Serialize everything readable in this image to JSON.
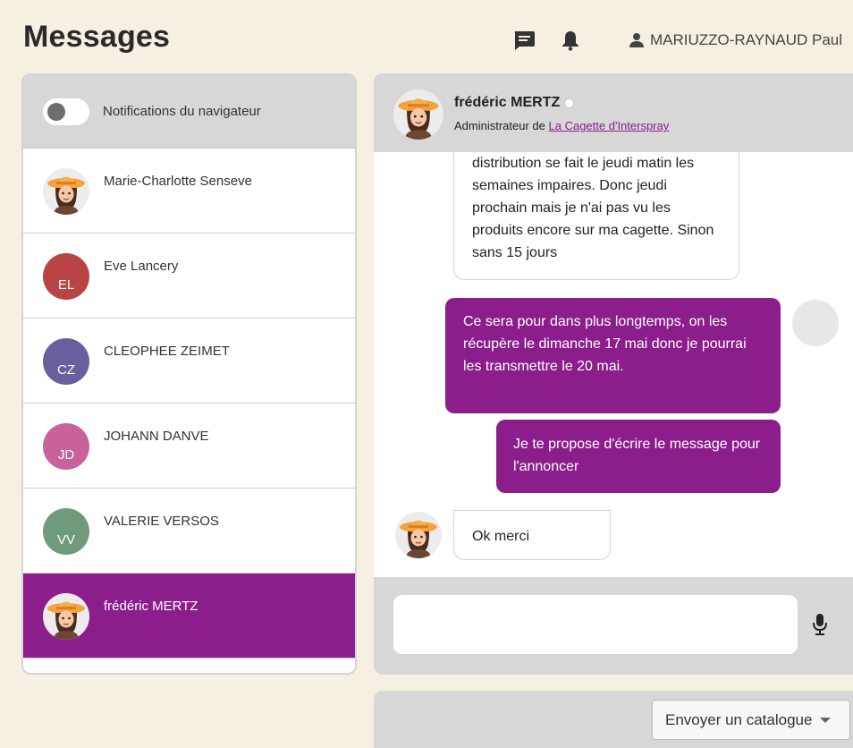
{
  "page": {
    "title": "Messages"
  },
  "header": {
    "user_name": "MARIUZZO-RAYNAUD Paul",
    "icons": [
      "chat-icon",
      "bell-icon",
      "user-icon"
    ]
  },
  "sidebar": {
    "notification_toggle_label": "Notifications du navigateur",
    "notification_toggle_on": false,
    "conversations": [
      {
        "name": "Marie-Charlotte Senseve",
        "initials": "",
        "avatar": "farmer-avatar",
        "color": "#eeeeee",
        "active": false
      },
      {
        "name": "Eve Lancery",
        "initials": "EL",
        "avatar": "initials",
        "color": "#b94444",
        "active": false
      },
      {
        "name": "CLEOPHEE ZEIMET",
        "initials": "CZ",
        "avatar": "initials",
        "color": "#6a5f9e",
        "active": false
      },
      {
        "name": "JOHANN DANVE",
        "initials": "JD",
        "avatar": "initials",
        "color": "#c9629c",
        "active": false
      },
      {
        "name": "VALERIE VERSOS",
        "initials": "VV",
        "avatar": "initials",
        "color": "#6f9a7b",
        "active": false
      },
      {
        "name": "frédéric MERTZ",
        "initials": "",
        "avatar": "farmer-avatar",
        "color": "#8b1e8b",
        "active": true
      }
    ]
  },
  "chat": {
    "contact_name": "frédéric MERTZ",
    "contact_status": "offline",
    "role_prefix": "Administrateur de",
    "role_link": "La Cagette d'Interspray",
    "messages": [
      {
        "direction": "in",
        "text": "distribution se fait le jeudi matin les semaines impaires. Donc jeudi prochain mais je n'ai pas vu les produits encore sur ma cagette. Sinon sans 15 jours"
      },
      {
        "direction": "out",
        "text": "Ce sera pour dans plus longtemps, on les récupère le dimanche 17 mai donc je pourrai les transmettre le 20 mai."
      },
      {
        "direction": "out",
        "text": "Je te propose d'écrire le message pour l'annoncer"
      },
      {
        "direction": "in",
        "text": "Ok merci"
      }
    ],
    "composer_value": "",
    "composer_placeholder": "",
    "mic_icon": "microphone-icon"
  },
  "footer": {
    "catalog_select_label": "Envoyer un catalogue"
  },
  "colors": {
    "accent": "#8b1e8b",
    "background": "#f5f0e1",
    "panel": "#d7d7d7"
  }
}
